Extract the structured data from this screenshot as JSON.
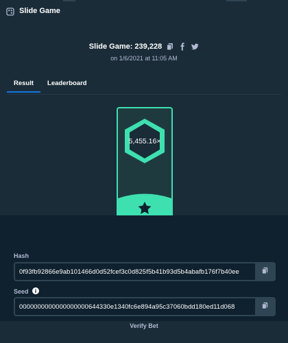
{
  "titlebar": {
    "title": "Slide Game",
    "icon": "dice-icon"
  },
  "header": {
    "game_title": "Slide Game: 239,228",
    "date_text": "on 1/6/2021 at 11:05 AM",
    "icons": [
      "copy-icon",
      "facebook-icon",
      "twitter-icon"
    ]
  },
  "tabs": [
    {
      "label": "Result",
      "active": true
    },
    {
      "label": "Leaderboard",
      "active": false
    }
  ],
  "result": {
    "multiplier": "5,455.16×",
    "icon": "star-icon"
  },
  "fairness": {
    "hash_label": "Hash",
    "hash_value": "0f93fb92866e9ab101466d0d52fcef3c0d825f5b41b93d5b4abafb176f7b40ee",
    "seed_label": "Seed",
    "seed_value": "0000000000000000000644330e1340fc6e894a95c37060bdd180ed11d068",
    "verify_label": "Verify Bet"
  },
  "colors": {
    "background": "#0f212e",
    "panel": "#1a2c38",
    "accent_green": "#3ee0b0",
    "tab_active": "#1475e1"
  }
}
